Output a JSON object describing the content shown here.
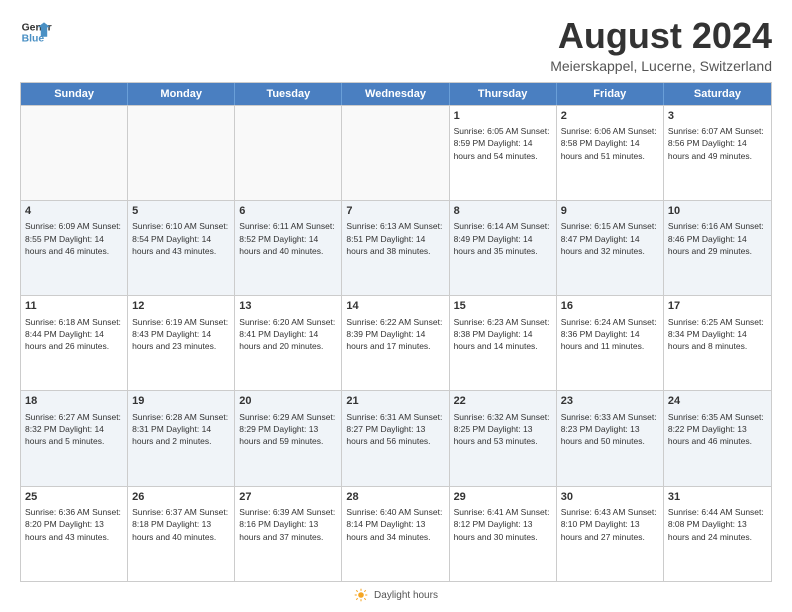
{
  "header": {
    "logo": {
      "line1": "General",
      "line2": "Blue"
    },
    "title": "August 2024",
    "subtitle": "Meierskappel, Lucerne, Switzerland"
  },
  "calendar": {
    "days": [
      "Sunday",
      "Monday",
      "Tuesday",
      "Wednesday",
      "Thursday",
      "Friday",
      "Saturday"
    ],
    "rows": [
      [
        {
          "day": "",
          "info": ""
        },
        {
          "day": "",
          "info": ""
        },
        {
          "day": "",
          "info": ""
        },
        {
          "day": "",
          "info": ""
        },
        {
          "day": "1",
          "info": "Sunrise: 6:05 AM\nSunset: 8:59 PM\nDaylight: 14 hours\nand 54 minutes."
        },
        {
          "day": "2",
          "info": "Sunrise: 6:06 AM\nSunset: 8:58 PM\nDaylight: 14 hours\nand 51 minutes."
        },
        {
          "day": "3",
          "info": "Sunrise: 6:07 AM\nSunset: 8:56 PM\nDaylight: 14 hours\nand 49 minutes."
        }
      ],
      [
        {
          "day": "4",
          "info": "Sunrise: 6:09 AM\nSunset: 8:55 PM\nDaylight: 14 hours\nand 46 minutes."
        },
        {
          "day": "5",
          "info": "Sunrise: 6:10 AM\nSunset: 8:54 PM\nDaylight: 14 hours\nand 43 minutes."
        },
        {
          "day": "6",
          "info": "Sunrise: 6:11 AM\nSunset: 8:52 PM\nDaylight: 14 hours\nand 40 minutes."
        },
        {
          "day": "7",
          "info": "Sunrise: 6:13 AM\nSunset: 8:51 PM\nDaylight: 14 hours\nand 38 minutes."
        },
        {
          "day": "8",
          "info": "Sunrise: 6:14 AM\nSunset: 8:49 PM\nDaylight: 14 hours\nand 35 minutes."
        },
        {
          "day": "9",
          "info": "Sunrise: 6:15 AM\nSunset: 8:47 PM\nDaylight: 14 hours\nand 32 minutes."
        },
        {
          "day": "10",
          "info": "Sunrise: 6:16 AM\nSunset: 8:46 PM\nDaylight: 14 hours\nand 29 minutes."
        }
      ],
      [
        {
          "day": "11",
          "info": "Sunrise: 6:18 AM\nSunset: 8:44 PM\nDaylight: 14 hours\nand 26 minutes."
        },
        {
          "day": "12",
          "info": "Sunrise: 6:19 AM\nSunset: 8:43 PM\nDaylight: 14 hours\nand 23 minutes."
        },
        {
          "day": "13",
          "info": "Sunrise: 6:20 AM\nSunset: 8:41 PM\nDaylight: 14 hours\nand 20 minutes."
        },
        {
          "day": "14",
          "info": "Sunrise: 6:22 AM\nSunset: 8:39 PM\nDaylight: 14 hours\nand 17 minutes."
        },
        {
          "day": "15",
          "info": "Sunrise: 6:23 AM\nSunset: 8:38 PM\nDaylight: 14 hours\nand 14 minutes."
        },
        {
          "day": "16",
          "info": "Sunrise: 6:24 AM\nSunset: 8:36 PM\nDaylight: 14 hours\nand 11 minutes."
        },
        {
          "day": "17",
          "info": "Sunrise: 6:25 AM\nSunset: 8:34 PM\nDaylight: 14 hours\nand 8 minutes."
        }
      ],
      [
        {
          "day": "18",
          "info": "Sunrise: 6:27 AM\nSunset: 8:32 PM\nDaylight: 14 hours\nand 5 minutes."
        },
        {
          "day": "19",
          "info": "Sunrise: 6:28 AM\nSunset: 8:31 PM\nDaylight: 14 hours\nand 2 minutes."
        },
        {
          "day": "20",
          "info": "Sunrise: 6:29 AM\nSunset: 8:29 PM\nDaylight: 13 hours\nand 59 minutes."
        },
        {
          "day": "21",
          "info": "Sunrise: 6:31 AM\nSunset: 8:27 PM\nDaylight: 13 hours\nand 56 minutes."
        },
        {
          "day": "22",
          "info": "Sunrise: 6:32 AM\nSunset: 8:25 PM\nDaylight: 13 hours\nand 53 minutes."
        },
        {
          "day": "23",
          "info": "Sunrise: 6:33 AM\nSunset: 8:23 PM\nDaylight: 13 hours\nand 50 minutes."
        },
        {
          "day": "24",
          "info": "Sunrise: 6:35 AM\nSunset: 8:22 PM\nDaylight: 13 hours\nand 46 minutes."
        }
      ],
      [
        {
          "day": "25",
          "info": "Sunrise: 6:36 AM\nSunset: 8:20 PM\nDaylight: 13 hours\nand 43 minutes."
        },
        {
          "day": "26",
          "info": "Sunrise: 6:37 AM\nSunset: 8:18 PM\nDaylight: 13 hours\nand 40 minutes."
        },
        {
          "day": "27",
          "info": "Sunrise: 6:39 AM\nSunset: 8:16 PM\nDaylight: 13 hours\nand 37 minutes."
        },
        {
          "day": "28",
          "info": "Sunrise: 6:40 AM\nSunset: 8:14 PM\nDaylight: 13 hours\nand 34 minutes."
        },
        {
          "day": "29",
          "info": "Sunrise: 6:41 AM\nSunset: 8:12 PM\nDaylight: 13 hours\nand 30 minutes."
        },
        {
          "day": "30",
          "info": "Sunrise: 6:43 AM\nSunset: 8:10 PM\nDaylight: 13 hours\nand 27 minutes."
        },
        {
          "day": "31",
          "info": "Sunrise: 6:44 AM\nSunset: 8:08 PM\nDaylight: 13 hours\nand 24 minutes."
        }
      ]
    ]
  },
  "footer": {
    "text": "Daylight hours"
  }
}
